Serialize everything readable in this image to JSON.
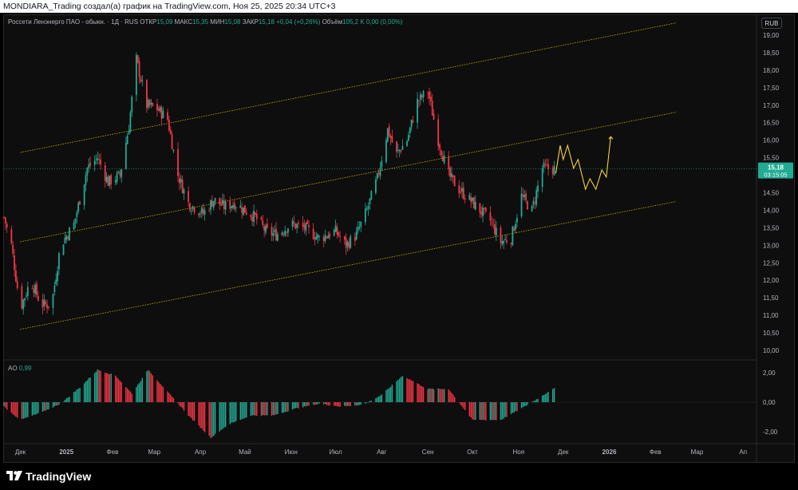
{
  "header": {
    "text": "MONDIARA_Trading создал(а) график на TradingView.com, Ноя 25, 2025 20:34 UTC+3"
  },
  "legend": {
    "symbol": "Россети Ленэнерго ПАО - обыкн. · 1Д · RUS",
    "open_label": "ОТКР",
    "open": "15,09",
    "high_label": "МАКС",
    "high": "15,35",
    "low_label": "МИН",
    "low": "15,08",
    "close_label": "ЗАКР",
    "close": "15,18",
    "change": "+0,04 (+0,26%)",
    "volume_label": "Объём",
    "volume": "105,2 K",
    "volume_change": "0,00 (0,00%)"
  },
  "currency": "RUB",
  "price_badge": {
    "price": "15,18",
    "countdown": "03:15:05"
  },
  "ao": {
    "label": "AO",
    "value": "0,99"
  },
  "footer": {
    "brand": "TradingView"
  },
  "colors": {
    "up": "#22ab94",
    "down": "#f23645",
    "channel": "#c8b400",
    "projection": "#f5d23c",
    "badge": "#22ab94"
  },
  "chart_data": [
    {
      "type": "candlestick",
      "title": "Россети Ленэнерго ПАО - обыкн. · 1Д · RUS",
      "ylim": [
        9.8,
        19.2
      ],
      "y_ticks": [
        "19,00",
        "18,50",
        "18,00",
        "17,50",
        "17,00",
        "16,50",
        "16,00",
        "15,50",
        "15,00",
        "14,50",
        "14,00",
        "13,50",
        "13,00",
        "12,50",
        "12,00",
        "11,50",
        "11,00",
        "10,50",
        "10,00"
      ],
      "x_ticks": [
        "Дек",
        "2025",
        "Фев",
        "Мар",
        "Апр",
        "Май",
        "Июн",
        "Июл",
        "Авг",
        "Сен",
        "Окт",
        "Ноя",
        "Дек",
        "2026",
        "Фев",
        "Мар",
        "Ап"
      ],
      "x_range": [
        "2024-11-20",
        "2026-04-10"
      ],
      "price_path": [
        [
          "2024-11-20",
          13.8
        ],
        [
          "2024-11-25",
          13.0
        ],
        [
          "2024-12-01",
          11.2
        ],
        [
          "2024-12-08",
          12.0
        ],
        [
          "2024-12-15",
          11.3
        ],
        [
          "2024-12-22",
          11.3
        ],
        [
          "2024-12-28",
          13.0
        ],
        [
          "2025-01-06",
          13.6
        ],
        [
          "2025-01-15",
          15.2
        ],
        [
          "2025-01-22",
          15.5
        ],
        [
          "2025-01-29",
          14.8
        ],
        [
          "2025-02-06",
          15.0
        ],
        [
          "2025-02-12",
          16.4
        ],
        [
          "2025-02-17",
          18.3
        ],
        [
          "2025-02-24",
          17.0
        ],
        [
          "2025-03-03",
          16.9
        ],
        [
          "2025-03-10",
          16.6
        ],
        [
          "2025-03-17",
          15.0
        ],
        [
          "2025-03-24",
          14.2
        ],
        [
          "2025-04-03",
          13.9
        ],
        [
          "2025-04-10",
          14.3
        ],
        [
          "2025-04-17",
          14.1
        ],
        [
          "2025-04-24",
          14.2
        ],
        [
          "2025-05-08",
          13.8
        ],
        [
          "2025-05-15",
          13.4
        ],
        [
          "2025-05-22",
          13.3
        ],
        [
          "2025-06-01",
          13.6
        ],
        [
          "2025-06-10",
          13.5
        ],
        [
          "2025-06-20",
          13.2
        ],
        [
          "2025-07-01",
          13.4
        ],
        [
          "2025-07-08",
          13.0
        ],
        [
          "2025-07-15",
          13.3
        ],
        [
          "2025-07-22",
          14.0
        ],
        [
          "2025-07-29",
          14.9
        ],
        [
          "2025-08-05",
          16.3
        ],
        [
          "2025-08-11",
          15.6
        ],
        [
          "2025-08-18",
          16.0
        ],
        [
          "2025-08-25",
          17.1
        ],
        [
          "2025-09-01",
          17.4
        ],
        [
          "2025-09-08",
          16.0
        ],
        [
          "2025-09-15",
          15.0
        ],
        [
          "2025-09-22",
          14.6
        ],
        [
          "2025-09-29",
          14.3
        ],
        [
          "2025-10-06",
          14.0
        ],
        [
          "2025-10-13",
          13.7
        ],
        [
          "2025-10-20",
          13.1
        ],
        [
          "2025-10-27",
          13.2
        ],
        [
          "2025-11-03",
          14.4
        ],
        [
          "2025-11-10",
          14.0
        ],
        [
          "2025-11-17",
          15.2
        ],
        [
          "2025-11-25",
          15.18
        ]
      ],
      "channel_lines": [
        {
          "from": [
            "2024-12-01",
            15.65
          ],
          "to": [
            "2026-02-15",
            19.35
          ]
        },
        {
          "from": [
            "2024-12-01",
            13.1
          ],
          "to": [
            "2026-02-15",
            16.8
          ]
        },
        {
          "from": [
            "2024-12-01",
            10.6
          ],
          "to": [
            "2026-02-15",
            14.25
          ]
        }
      ],
      "projection": [
        [
          "2025-11-26",
          15.05
        ],
        [
          "2025-11-29",
          15.85
        ],
        [
          "2025-12-01",
          15.45
        ],
        [
          "2025-12-04",
          15.85
        ],
        [
          "2025-12-08",
          15.2
        ],
        [
          "2025-12-11",
          15.45
        ],
        [
          "2025-12-16",
          14.6
        ],
        [
          "2025-12-19",
          14.9
        ],
        [
          "2025-12-23",
          14.6
        ],
        [
          "2025-12-27",
          15.15
        ],
        [
          "2025-12-30",
          14.95
        ],
        [
          "2026-01-02",
          16.1
        ]
      ]
    },
    {
      "type": "bar",
      "title": "AO",
      "ylim": [
        -2.6,
        2.6
      ],
      "y_ticks": [
        "2,00",
        "0,00",
        "-2,00"
      ],
      "value_path": [
        [
          "2024-11-20",
          -0.3
        ],
        [
          "2024-12-01",
          -1.2
        ],
        [
          "2024-12-15",
          -0.7
        ],
        [
          "2024-12-28",
          -0.1
        ],
        [
          "2025-01-10",
          1.0
        ],
        [
          "2025-01-22",
          2.2
        ],
        [
          "2025-02-03",
          1.8
        ],
        [
          "2025-02-14",
          0.6
        ],
        [
          "2025-02-25",
          2.2
        ],
        [
          "2025-03-10",
          0.7
        ],
        [
          "2025-03-25",
          -1.0
        ],
        [
          "2025-04-08",
          -2.4
        ],
        [
          "2025-04-20",
          -1.5
        ],
        [
          "2025-05-05",
          -0.9
        ],
        [
          "2025-05-20",
          -0.9
        ],
        [
          "2025-06-05",
          -0.4
        ],
        [
          "2025-06-20",
          -0.1
        ],
        [
          "2025-07-05",
          -0.3
        ],
        [
          "2025-07-20",
          -0.15
        ],
        [
          "2025-08-01",
          0.5
        ],
        [
          "2025-08-15",
          1.8
        ],
        [
          "2025-09-01",
          0.9
        ],
        [
          "2025-09-15",
          0.9
        ],
        [
          "2025-10-01",
          -1.2
        ],
        [
          "2025-10-20",
          -1.2
        ],
        [
          "2025-11-05",
          -0.3
        ],
        [
          "2025-11-18",
          0.5
        ],
        [
          "2025-11-25",
          0.99
        ]
      ]
    }
  ]
}
